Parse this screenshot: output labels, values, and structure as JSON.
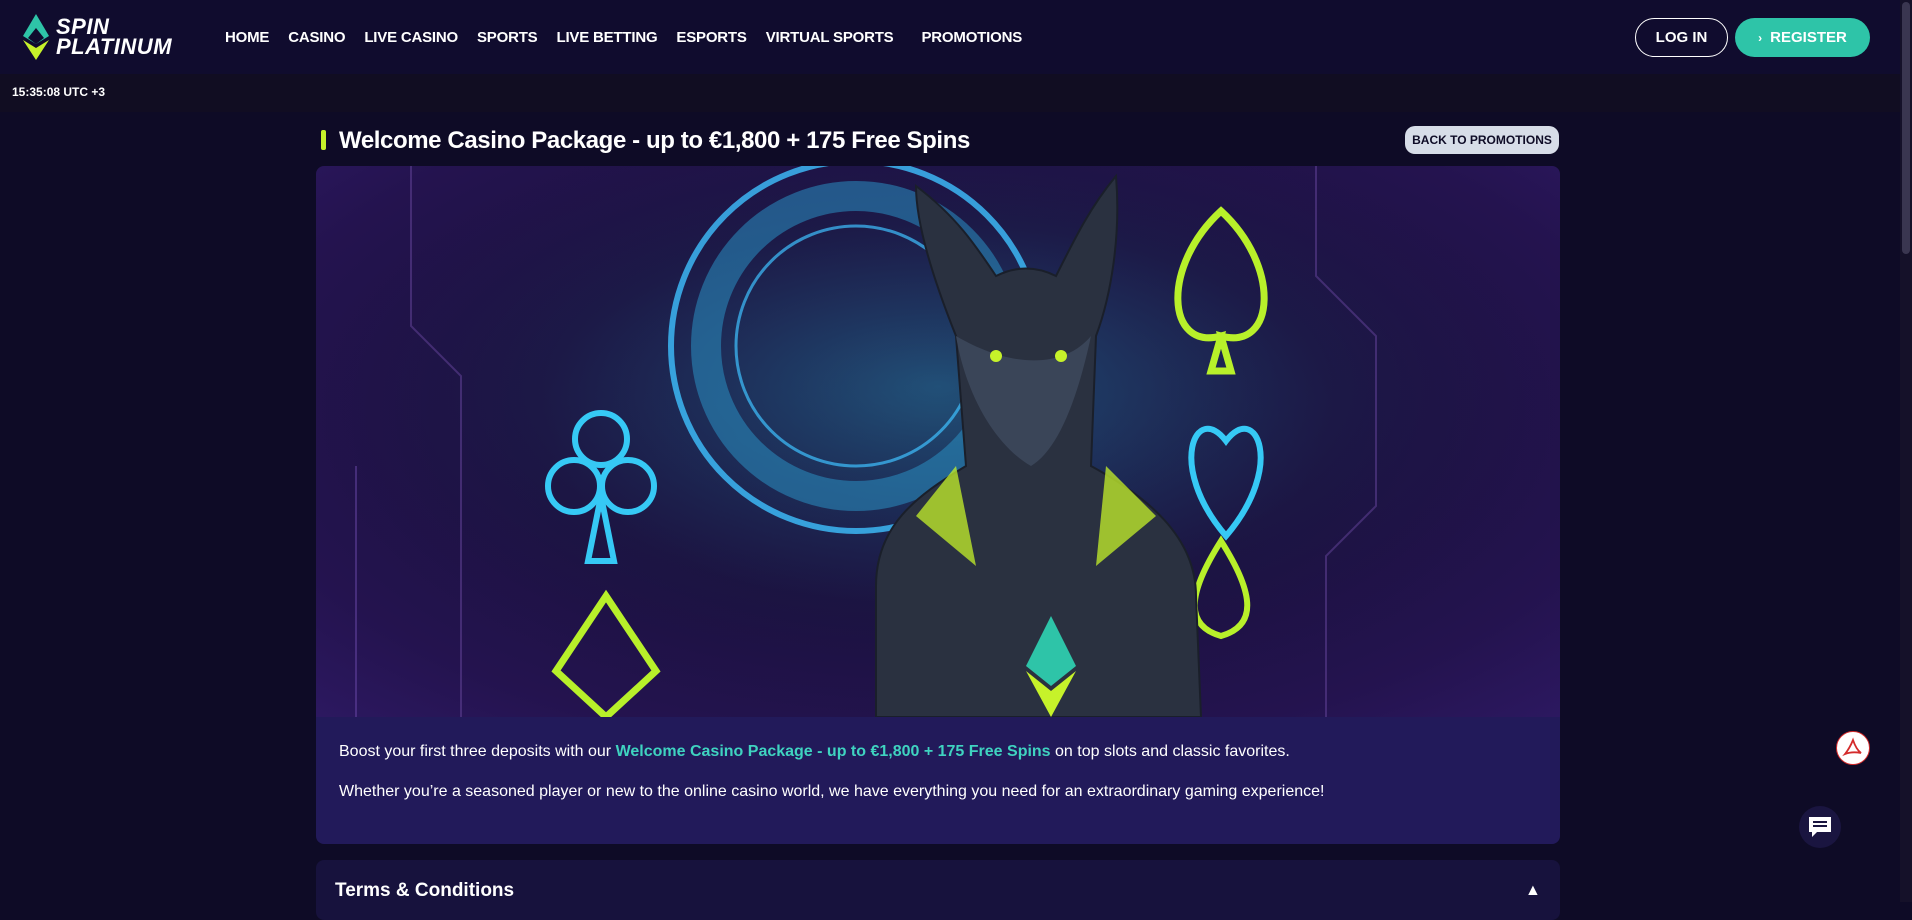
{
  "brand": {
    "line1": "SPIN",
    "line2": "PLATINUM",
    "accent": "#c6f22a",
    "teal": "#2ec4a8"
  },
  "nav": [
    "HOME",
    "CASINO",
    "LIVE CASINO",
    "SPORTS",
    "LIVE BETTING",
    "ESPORTS",
    "VIRTUAL SPORTS",
    "PROMOTIONS"
  ],
  "auth": {
    "login": "LOG IN",
    "register": "REGISTER"
  },
  "clock": "15:35:08 UTC +3",
  "promo": {
    "title": "Welcome Casino Package - up to €1,800 + 175 Free Spins",
    "back_label": "BACK TO PROMOTIONS",
    "desc1_before": "Boost your first three deposits with our ",
    "desc1_highlight": "Welcome Casino Package - up to €1,800 + 175 Free Spins",
    "desc1_after": " on top slots and classic favorites.",
    "desc2": "Whether you’re a seasoned player or new to the online casino world, we have everything you need for an extraordinary gaming experience!"
  },
  "terms": {
    "title": "Terms & Conditions",
    "toggle": "▲"
  },
  "icons": {
    "pdf": "pdf-icon",
    "chat": "chat-icon",
    "banner": "wolf-banner-image"
  }
}
